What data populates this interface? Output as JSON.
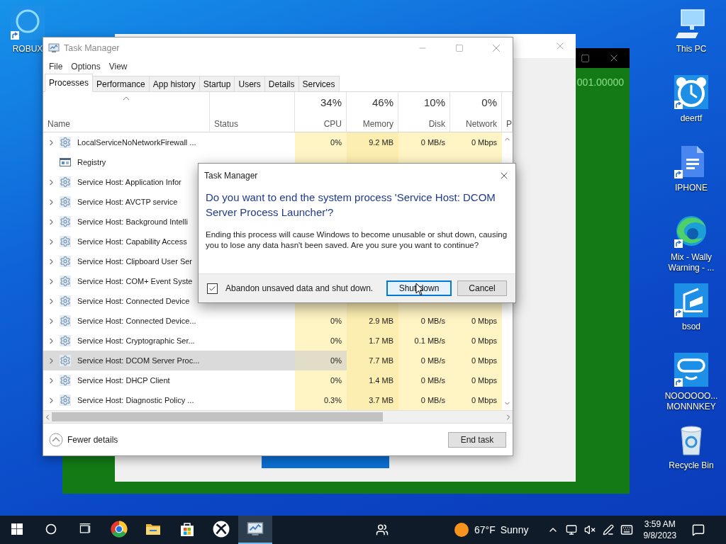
{
  "desktop_left": [
    {
      "label": "ROBUX",
      "kind": "ring",
      "shortcut": true
    }
  ],
  "desktop_right": [
    {
      "label": "This PC",
      "kind": "computer",
      "shortcut": false
    },
    {
      "label": "deertf",
      "kind": "alarm-clock",
      "shortcut": true
    },
    {
      "label": "IPHONE",
      "kind": "document",
      "shortcut": true
    },
    {
      "label": "Mix - Wally Warning - ...",
      "kind": "browser",
      "shortcut": true
    },
    {
      "label": "bsod",
      "kind": "chart",
      "shortcut": true
    },
    {
      "label": "NOOOOOO... MONNNKEY",
      "kind": "goggles",
      "shortcut": true
    },
    {
      "label": "Recycle Bin",
      "kind": "recycle-bin",
      "shortcut": false
    }
  ],
  "back_window": {
    "text": "001.00000"
  },
  "task_manager": {
    "title": "Task Manager",
    "menu": [
      "File",
      "Options",
      "View"
    ],
    "tabs": [
      {
        "label": "Processes",
        "selected": true
      },
      {
        "label": "Performance",
        "selected": false
      },
      {
        "label": "App history",
        "selected": false
      },
      {
        "label": "Startup",
        "selected": false
      },
      {
        "label": "Users",
        "selected": false
      },
      {
        "label": "Details",
        "selected": false
      },
      {
        "label": "Services",
        "selected": false
      }
    ],
    "columns": [
      {
        "label": "Name",
        "sorted": true
      },
      {
        "label": "Status",
        "sorted": false
      },
      {
        "percent": "34%",
        "label": "CPU",
        "sorted": false
      },
      {
        "percent": "46%",
        "label": "Memory",
        "sorted": false
      },
      {
        "percent": "10%",
        "label": "Disk",
        "sorted": false
      },
      {
        "percent": "0%",
        "label": "Network",
        "sorted": false
      },
      {
        "label": "P",
        "sorted": false
      }
    ],
    "rows": [
      {
        "name": "LocalServiceNoNetworkFirewall ...",
        "kind": "service",
        "expandable": true,
        "selected": false,
        "cpu": "0%",
        "memory": "9.2 MB",
        "disk": "0 MB/s",
        "network": "0 Mbps"
      },
      {
        "name": "Registry",
        "kind": "app",
        "expandable": false,
        "selected": false
      },
      {
        "name": "Service Host: Application Infor",
        "kind": "service",
        "expandable": true,
        "selected": false
      },
      {
        "name": "Service Host: AVCTP service",
        "kind": "service",
        "expandable": true,
        "selected": false
      },
      {
        "name": "Service Host: Background Intelli",
        "kind": "service",
        "expandable": true,
        "selected": false
      },
      {
        "name": "Service Host: Capability Access",
        "kind": "service",
        "expandable": true,
        "selected": false
      },
      {
        "name": "Service Host: Clipboard User Ser",
        "kind": "service",
        "expandable": true,
        "selected": false
      },
      {
        "name": "Service Host: COM+ Event Syste",
        "kind": "service",
        "expandable": true,
        "selected": false
      },
      {
        "name": "Service Host: Connected Device",
        "kind": "service",
        "expandable": true,
        "selected": false
      },
      {
        "name": "Service Host: Connected Device...",
        "kind": "service",
        "expandable": true,
        "selected": false,
        "cpu": "0%",
        "memory": "2.9 MB",
        "disk": "0 MB/s",
        "network": "0 Mbps"
      },
      {
        "name": "Service Host: Cryptographic Ser...",
        "kind": "service",
        "expandable": true,
        "selected": false,
        "cpu": "0%",
        "memory": "1.7 MB",
        "disk": "0.1 MB/s",
        "network": "0 Mbps"
      },
      {
        "name": "Service Host: DCOM Server Proc...",
        "kind": "service",
        "expandable": true,
        "selected": true,
        "cpu": "0%",
        "memory": "7.7 MB",
        "disk": "0 MB/s",
        "network": "0 Mbps"
      },
      {
        "name": "Service Host: DHCP Client",
        "kind": "service",
        "expandable": true,
        "selected": false,
        "cpu": "0%",
        "memory": "1.4 MB",
        "disk": "0 MB/s",
        "network": "0 Mbps"
      },
      {
        "name": "Service Host: Diagnostic Policy ...",
        "kind": "service",
        "expandable": true,
        "selected": false,
        "cpu": "0.3%",
        "memory": "3.7 MB",
        "disk": "0 MB/s",
        "network": "0 Mbps"
      }
    ],
    "fewer_details": "Fewer details",
    "end_task": "End task"
  },
  "dialog": {
    "title": "Task Manager",
    "heading": "Do you want to end the system process 'Service Host: DCOM Server Process Launcher'?",
    "message": "Ending this process will cause Windows to become unusable or shut down, causing you to lose any data hasn't been saved. Are you sure you want to continue?",
    "checkbox": {
      "label": "Abandon unsaved data and shut down.",
      "checked": true
    },
    "buttons": [
      {
        "label": "Shut down",
        "focused": true
      },
      {
        "label": "Cancel",
        "focused": false
      }
    ]
  },
  "taskbar": {
    "apps": [
      {
        "kind": "start",
        "active": false
      },
      {
        "kind": "search",
        "active": false
      },
      {
        "kind": "task-view",
        "active": false
      },
      {
        "kind": "chrome",
        "active": false
      },
      {
        "kind": "folder",
        "active": false
      },
      {
        "kind": "store",
        "active": false
      },
      {
        "kind": "xbox",
        "active": false
      },
      {
        "kind": "task-manager",
        "active": true
      }
    ],
    "weather": {
      "temperature": "67°F",
      "condition": "Sunny"
    },
    "clock": {
      "time": "3:59 AM",
      "date": "9/8/2023"
    }
  }
}
